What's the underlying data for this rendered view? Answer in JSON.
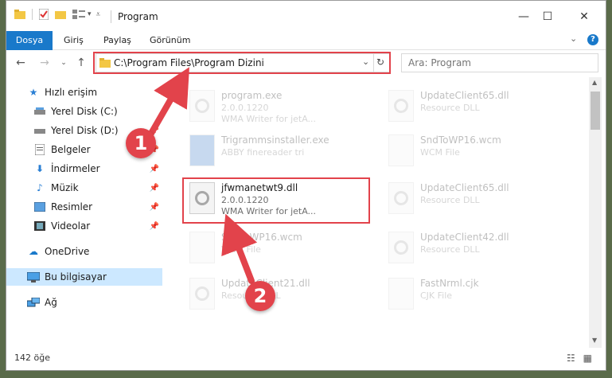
{
  "window": {
    "title": "Program",
    "minimize": "—",
    "maximize": "☐",
    "close": "✕"
  },
  "ribbon": {
    "tabs": [
      "Dosya",
      "Giriş",
      "Paylaş",
      "Görünüm"
    ]
  },
  "address": {
    "path": "C:\\Program Files\\Program Dizini",
    "search_placeholder": "Ara: Program"
  },
  "nav": {
    "items": [
      {
        "label": "Hızlı erişim",
        "icon": "star-icon"
      },
      {
        "label": "Yerel Disk (C:)",
        "icon": "drive-icon"
      },
      {
        "label": "Yerel Disk (D:)",
        "icon": "drive-icon"
      },
      {
        "label": "Belgeler",
        "icon": "documents-icon"
      },
      {
        "label": "İndirmeler",
        "icon": "download-icon"
      },
      {
        "label": "Müzik",
        "icon": "music-icon"
      },
      {
        "label": "Resimler",
        "icon": "pictures-icon"
      },
      {
        "label": "Videolar",
        "icon": "videos-icon"
      },
      {
        "label": "OneDrive",
        "icon": "cloud-icon"
      },
      {
        "label": "Bu bilgisayar",
        "icon": "computer-icon"
      },
      {
        "label": "Ağ",
        "icon": "network-icon"
      }
    ]
  },
  "files": [
    {
      "name": "program.exe",
      "line2": "2.0.0.1220",
      "line3": "WMA Writer for jetA..."
    },
    {
      "name": "Trigrammsinstaller.exe",
      "line2": "ABBY finereader tri",
      "line3": ""
    },
    {
      "name": "jfwmanetwt9.dll",
      "line2": "2.0.0.1220",
      "line3": "WMA Writer for jetA..."
    },
    {
      "name": "SndToWP16.wcm",
      "line2": "WCM File",
      "line3": ""
    },
    {
      "name": "UpdateClient21.dll",
      "line2": "Resource DLL",
      "line3": ""
    },
    {
      "name": "UpdateClient65.dll",
      "line2": "Resource DLL",
      "line3": ""
    },
    {
      "name": "SndToWP16.wcm",
      "line2": "WCM File",
      "line3": ""
    },
    {
      "name": "UpdateClient65.dll",
      "line2": "Resource DLL",
      "line3": ""
    },
    {
      "name": "UpdateClient42.dll",
      "line2": "Resource DLL",
      "line3": ""
    },
    {
      "name": "FastNrml.cjk",
      "line2": "CJK File",
      "line3": ""
    }
  ],
  "status": {
    "count": "142 öğe"
  },
  "annotations": {
    "step1": "1",
    "step2": "2"
  },
  "colors": {
    "accent": "#1979ca",
    "highlight": "#e2434b"
  }
}
